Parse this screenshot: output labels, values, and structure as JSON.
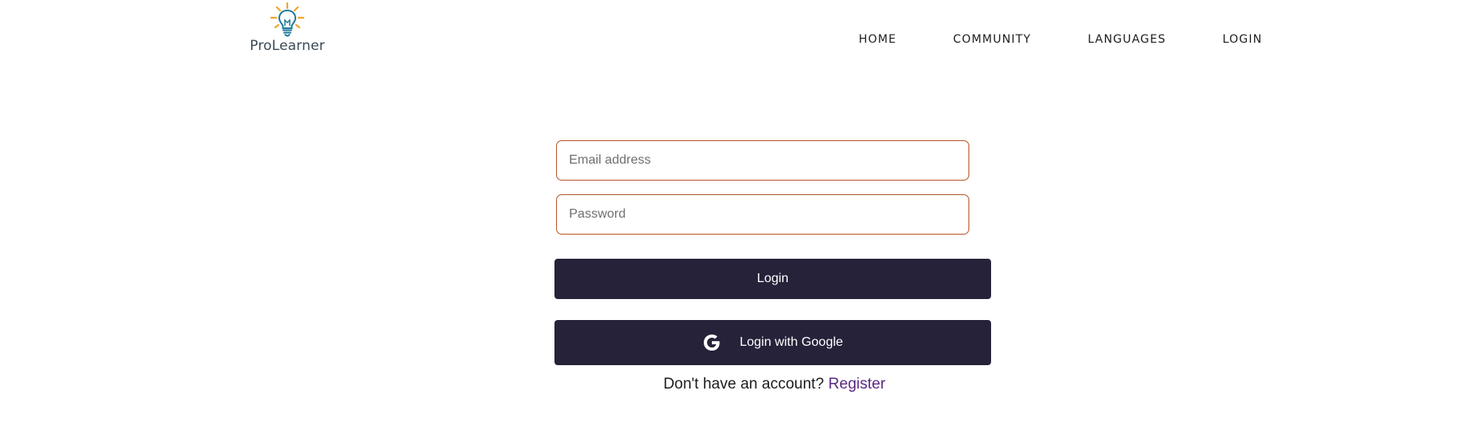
{
  "brand": {
    "name": "ProLearner",
    "icon": "lightbulb-icon",
    "colors": {
      "bulb": "#1f7a9c",
      "rays": "#f0a52a",
      "text": "#3b4a55"
    }
  },
  "nav": {
    "items": [
      {
        "label": "HOME"
      },
      {
        "label": "COMMUNITY"
      },
      {
        "label": "LANGUAGES"
      },
      {
        "label": "LOGIN"
      }
    ]
  },
  "form": {
    "email": {
      "placeholder": "Email address",
      "value": ""
    },
    "password": {
      "placeholder": "Password",
      "value": ""
    },
    "login_label": "Login",
    "google_label": "Login with Google",
    "google_icon": "google-icon",
    "register_prompt": "Don't have an account?",
    "register_link": "Register"
  },
  "colors": {
    "input_border": "#b5542a",
    "button_bg": "#25223a",
    "button_text": "#ffffff",
    "link": "#5b2a86"
  }
}
